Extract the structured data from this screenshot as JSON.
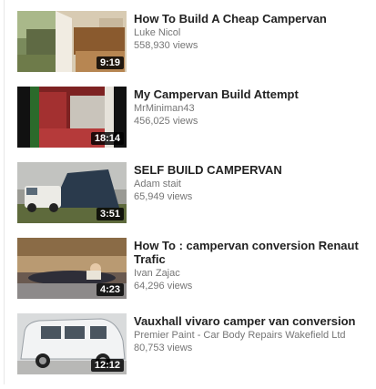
{
  "videos": [
    {
      "title": "How To Build A Cheap Campervan",
      "channel": "Luke Nicol",
      "views": "558,930 views",
      "duration": "9:19"
    },
    {
      "title": "My Campervan Build Attempt",
      "channel": "MrMiniman43",
      "views": "456,025 views",
      "duration": "18:14"
    },
    {
      "title": "SELF BUILD CAMPERVAN",
      "channel": "Adam stait",
      "views": "65,949 views",
      "duration": "3:51"
    },
    {
      "title": "How To : campervan conversion Renaut Trafic",
      "channel": "Ivan Zajac",
      "views": "64,296 views",
      "duration": "4:23"
    },
    {
      "title": "Vauxhall vivaro camper van conversion",
      "channel": "Premier Paint - Car Body Repairs Wakefield Ltd",
      "views": "80,753 views",
      "duration": "12:12"
    }
  ],
  "colors": {
    "title": "#222222",
    "meta": "#767676",
    "duration_bg": "#000000"
  }
}
